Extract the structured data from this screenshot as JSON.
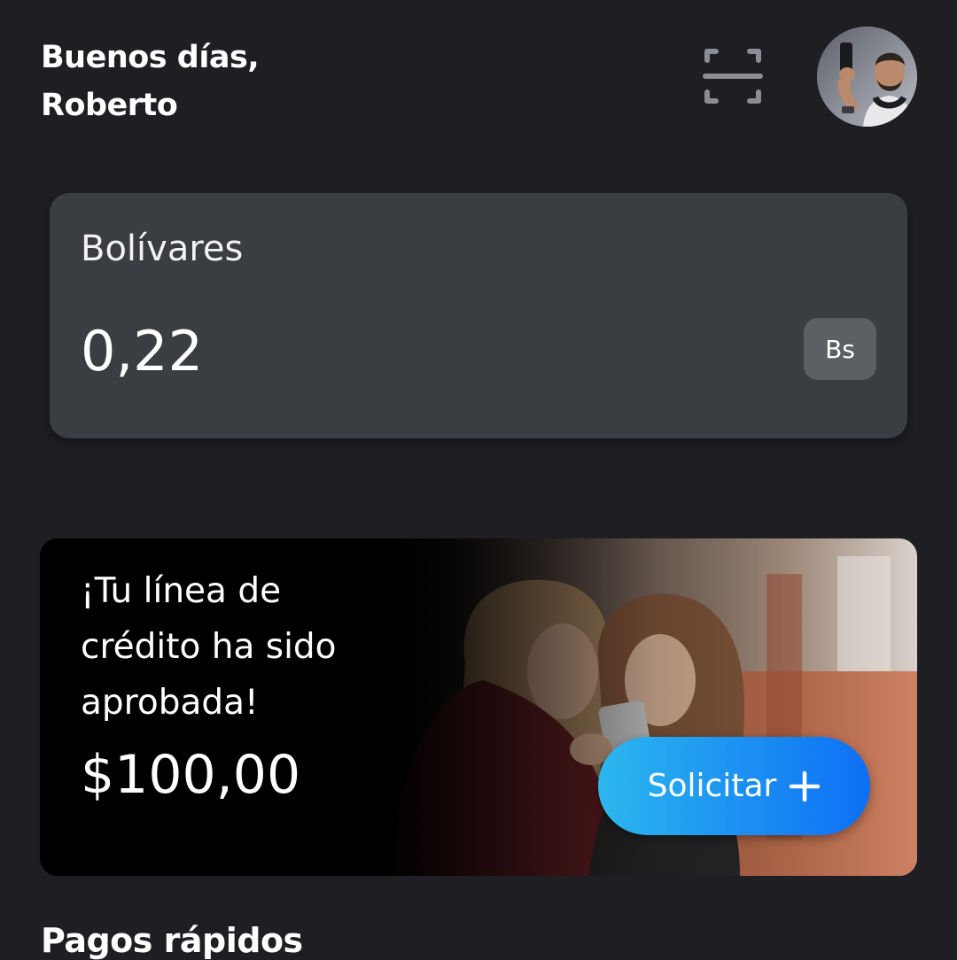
{
  "header": {
    "greeting_line1": "Buenos días,",
    "greeting_line2": "Roberto",
    "scan_icon": "scan-qr-icon",
    "avatar_icon": "user-avatar"
  },
  "balance": {
    "title": "Bolívares",
    "amount": "0,22",
    "currency_code": "Bs"
  },
  "promo": {
    "line1": "¡Tu línea de",
    "line2": "crédito ha sido",
    "line3": "aprobada!",
    "amount": "$100,00",
    "button_label": "Solicitar",
    "button_icon": "plus-icon",
    "button_gradient": [
      "#2cb7ee",
      "#0d6ff5"
    ]
  },
  "sections": {
    "quick_payments_title": "Pagos rápidos"
  },
  "colors": {
    "background": "#1f1e22",
    "card": "#3a3d41",
    "badge": "#5c6065",
    "accent": "#1b8ff2"
  }
}
